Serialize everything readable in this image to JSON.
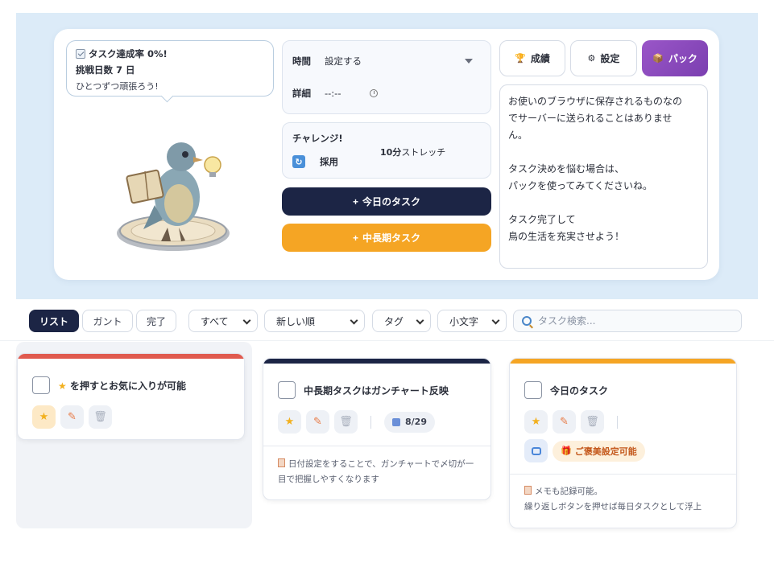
{
  "bubble": {
    "rate_line": "タスク達成率 0%!",
    "days_line": "挑戦日数 7 日",
    "cheer_line": "ひとつずつ頑張ろう!"
  },
  "time_panel": {
    "time_label": "時間",
    "time_value": "設定する",
    "detail_label": "詳細",
    "detail_value": "--:--"
  },
  "challenge": {
    "title": "チャレンジ!",
    "adopt_label": "採用",
    "task_bold": "10分",
    "task_rest": "ストレッチ"
  },
  "buttons": {
    "today_task": "今日のタスク",
    "long_task": "中長期タスク",
    "plus": "+",
    "achievements": "成績",
    "settings": "設定",
    "pack": "パック"
  },
  "info": {
    "line1": "お使いのブラウザに保存されるものなの",
    "line2": "でサーバーに送られることはありませ",
    "line3": "ん。",
    "line4": "タスク決めを悩む場合は、",
    "line5": "パックを使ってみてくださいね。",
    "line6": "タスク完了して",
    "line7": "鳥の生活を充実させよう！"
  },
  "toolbar": {
    "view_list": "リスト",
    "view_gantt": "ガント",
    "view_done": "完了",
    "filter_all": "すべて",
    "sort_new": "新しい順",
    "tag": "タグ",
    "case": "小文字",
    "search_placeholder": "タスク検索..."
  },
  "cards": [
    {
      "title": "を押すとお気に入りが可能",
      "bar_color": "#e05a4e"
    },
    {
      "title": "中長期タスクはガンチャート反映",
      "bar_color": "#1c2545",
      "date": "8/29",
      "note": "日付設定をすることで、ガンチャートで〆切が一目で把握しやすくなります"
    },
    {
      "title": "今日のタスク",
      "bar_color": "#f5a524",
      "reward": "ご褒美設定可能",
      "note_line1": "メモも記録可能。",
      "note_line2": "繰り返しボタンを押せば毎日タスクとして浮上"
    }
  ],
  "colors": {
    "navy": "#1c2545",
    "orange": "#f5a524",
    "purple": "#8a4cc0",
    "hero_bg": "#dcebf8"
  }
}
